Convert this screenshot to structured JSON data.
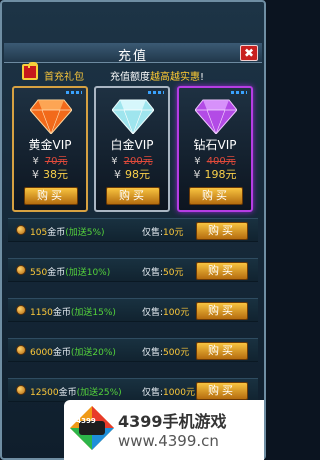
{
  "dialog": {
    "title": "充值",
    "close_label": "✖"
  },
  "gift": {
    "label": "首充礼包",
    "tip_prefix": "充值额度",
    "tip_highlight": "越高越实惠",
    "tip_suffix": "!"
  },
  "vip_cards": [
    {
      "name": "黄金VIP",
      "currency": "¥",
      "old_price": "70元",
      "new_price": "38元",
      "buy_label": "购买",
      "gem_color": "#f26a1b"
    },
    {
      "name": "白金VIP",
      "currency": "¥",
      "old_price": "200元",
      "new_price": "98元",
      "buy_label": "购买",
      "gem_color": "#9fe5ee"
    },
    {
      "name": "钻石VIP",
      "currency": "¥",
      "old_price": "400元",
      "new_price": "198元",
      "buy_label": "购买",
      "gem_color": "#b34be6"
    }
  ],
  "coin_packs": [
    {
      "amount": "105",
      "unit": "金币",
      "bonus": "(加送5%)",
      "price_label": "仅售:",
      "price": "10元",
      "buy_label": "购买"
    },
    {
      "amount": "550",
      "unit": "金币",
      "bonus": "(加送10%)",
      "price_label": "仅售:",
      "price": "50元",
      "buy_label": "购买"
    },
    {
      "amount": "1150",
      "unit": "金币",
      "bonus": "(加送15%)",
      "price_label": "仅售:",
      "price": "100元",
      "buy_label": "购买"
    },
    {
      "amount": "6000",
      "unit": "金币",
      "bonus": "(加送20%)",
      "price_label": "仅售:",
      "price": "500元",
      "buy_label": "购买"
    },
    {
      "amount": "12500",
      "unit": "金币",
      "bonus": "(加送25%)",
      "price_label": "仅售:",
      "price": "1000元",
      "buy_label": "购买"
    }
  ],
  "watermark": {
    "logo_text": "4399",
    "line1": "4399手机游戏",
    "line2": "www.4399.cn"
  }
}
